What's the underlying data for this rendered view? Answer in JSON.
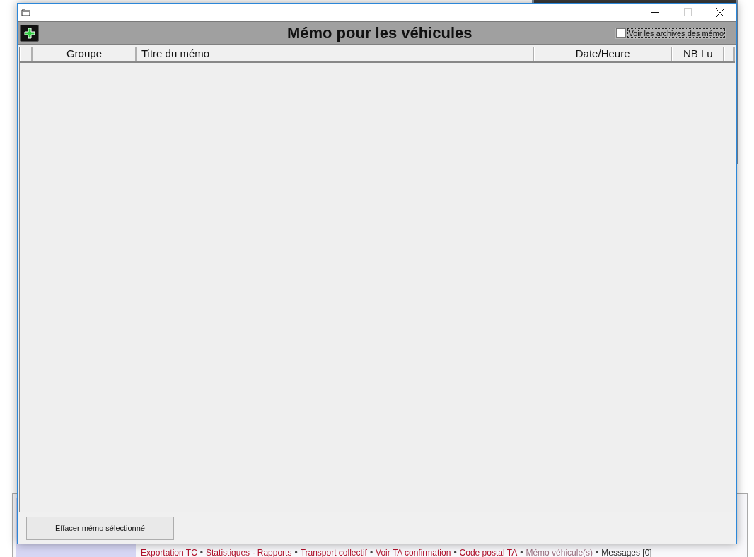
{
  "background": {
    "footer_links": [
      {
        "label": "Exportation TC",
        "kind": "link"
      },
      {
        "label": "Statistiques - Rapports",
        "kind": "link"
      },
      {
        "label": "Transport collectif",
        "kind": "link"
      },
      {
        "label": "Voir TA confirmation",
        "kind": "link"
      },
      {
        "label": "Code postal TA",
        "kind": "link"
      },
      {
        "label": "Mémo véhicule(s)",
        "kind": "current"
      },
      {
        "label": "Messages [0]",
        "kind": "plain"
      }
    ],
    "separator": "•"
  },
  "window": {
    "title": "Mémo pour les véhicules",
    "archive_checkbox": {
      "label": "Voir les archives des mémo",
      "checked": false
    },
    "table": {
      "columns": [
        "Groupe",
        "Titre du mémo",
        "Date/Heure",
        "NB Lu"
      ]
    },
    "buttons": [
      "Effacer mémo sélectionné"
    ]
  }
}
